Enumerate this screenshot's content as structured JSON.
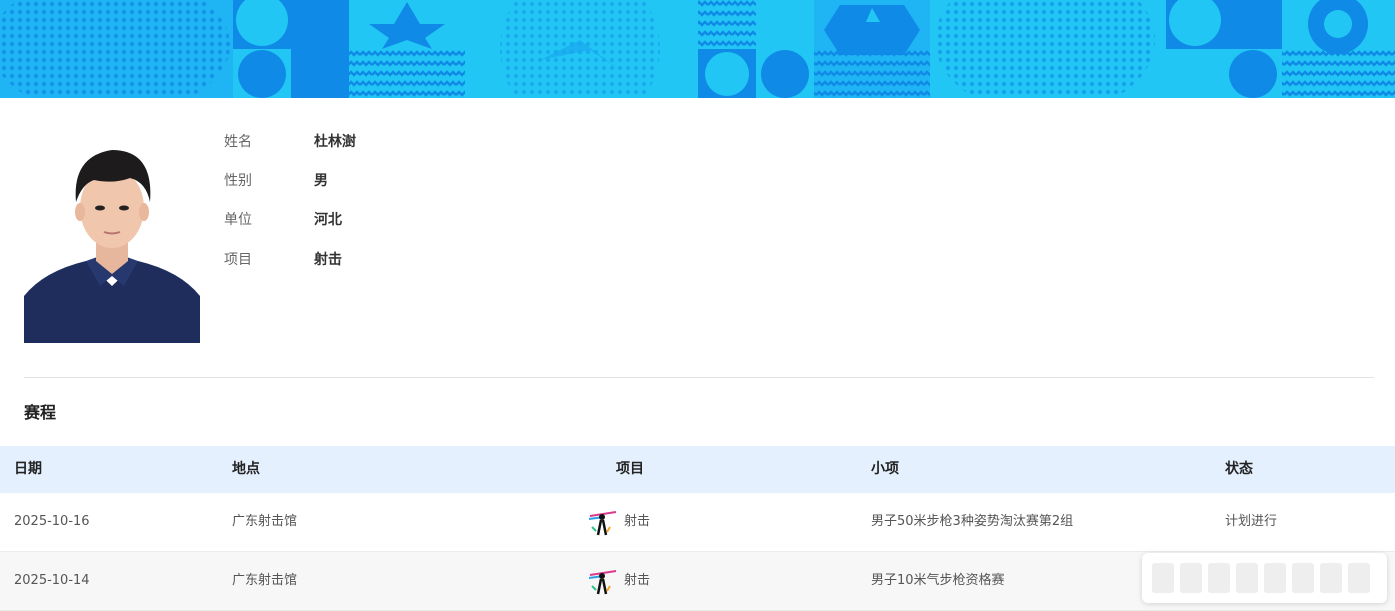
{
  "profile": {
    "fields": [
      {
        "label": "姓名",
        "value": "杜林澍"
      },
      {
        "label": "性别",
        "value": "男"
      },
      {
        "label": "单位",
        "value": "河北"
      },
      {
        "label": "项目",
        "value": "射击"
      }
    ]
  },
  "schedule": {
    "title": "赛程",
    "headers": {
      "date": "日期",
      "venue": "地点",
      "sport": "项目",
      "event": "小项",
      "status": "状态"
    },
    "rows": [
      {
        "date": "2025-10-16",
        "venue": "广东射击馆",
        "sport": "射击",
        "sport_icon": "shooting-icon",
        "event": "男子50米步枪3种姿势淘汰赛第2组",
        "status": "计划进行"
      },
      {
        "date": "2025-10-14",
        "venue": "广东射击馆",
        "sport": "射击",
        "sport_icon": "shooting-icon",
        "event": "男子10米气步枪资格赛",
        "status": ""
      }
    ]
  },
  "colors": {
    "banner_primary": "#0f8ae6",
    "banner_secondary": "#22c6f5",
    "table_header_bg": "#e4f0fd"
  }
}
